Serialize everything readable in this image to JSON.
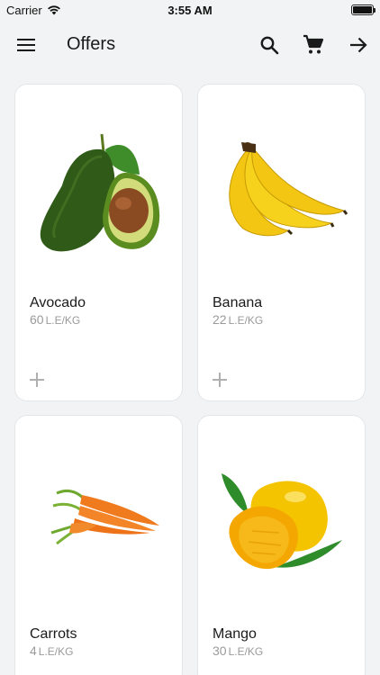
{
  "status_bar": {
    "carrier": "Carrier",
    "time": "3:55 AM"
  },
  "header": {
    "title": "Offers"
  },
  "icons": {
    "menu": "menu-icon",
    "search": "search-icon",
    "cart": "cart-icon",
    "forward": "arrow-right-icon",
    "add": "plus-icon"
  },
  "products": [
    {
      "name": "Avocado",
      "price": "60",
      "unit": "L.E/KG"
    },
    {
      "name": "Banana",
      "price": "22",
      "unit": "L.E/KG"
    },
    {
      "name": "Carrots",
      "price": "4",
      "unit": "L.E/KG"
    },
    {
      "name": "Mango",
      "price": "30",
      "unit": "L.E/KG"
    }
  ],
  "colors": {
    "background": "#f2f3f4",
    "card": "#ffffff",
    "price_text": "#9a9a9a"
  }
}
